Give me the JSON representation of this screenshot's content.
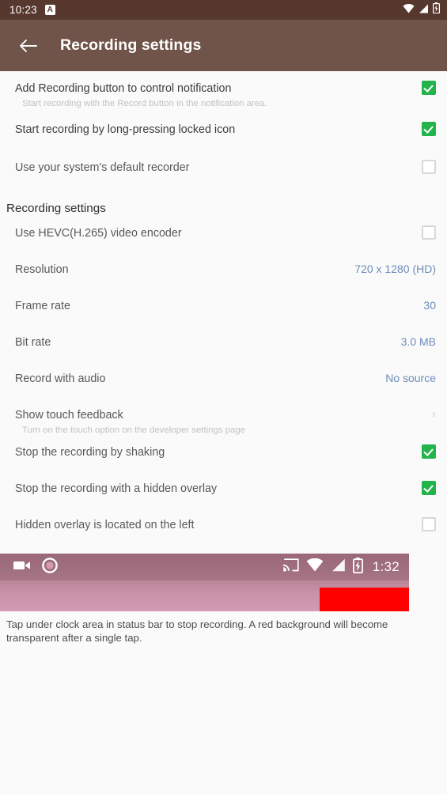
{
  "system_status_bar": {
    "clock": "10:23",
    "badge_label": "A",
    "icons": [
      "wifi-icon",
      "signal-icon",
      "battery-charging-icon"
    ]
  },
  "app_bar": {
    "back_label": "←",
    "title": "Recording settings",
    "background_color": "#70544a"
  },
  "preferences": [
    {
      "title": "Add Recording button to control notification",
      "summary": "Start recording with the Record button in the notification area.",
      "checkbox": "checked"
    },
    {
      "title": "Start recording by long-pressing locked icon",
      "checkbox": "checked"
    },
    {
      "title": "Use your system's default recorder",
      "checkbox": "unchecked"
    }
  ],
  "section": {
    "header": "Recording settings",
    "rows": [
      {
        "title": "Use HEVC(H.265) video encoder",
        "checkbox": "unchecked"
      },
      {
        "title": "Resolution",
        "value": "720 x 1280 (HD)"
      },
      {
        "title": "Frame rate",
        "value": "30"
      },
      {
        "title": "Bit rate",
        "value": "3.0 MB"
      },
      {
        "title": "Record with audio",
        "value": "No source"
      },
      {
        "title": "Show touch feedback",
        "summary": "Turn on the touch option on the developer settings page",
        "chevron": "›"
      },
      {
        "title": "Stop the recording by shaking",
        "checkbox": "checked"
      },
      {
        "title": "Stop the recording with a hidden overlay",
        "checkbox": "checked"
      },
      {
        "title": "Hidden overlay is located on the left",
        "checkbox": "unchecked"
      }
    ]
  },
  "preview": {
    "clock": "1:32",
    "left_icons": [
      "videocam-icon",
      "record-circle-icon"
    ],
    "right_icons": [
      "cast-icon",
      "wifi-icon",
      "signal-icon",
      "battery-charging-icon"
    ],
    "red_block_color": "#fe0000"
  },
  "caption": "Tap under clock area in status bar to stop recording. A red background will become transparent after a single tap.",
  "colors": {
    "status_bar": "#56382e",
    "app_bar": "#70544a",
    "checkbox_on": "#22b34b",
    "value_text": "#6d8cb8",
    "page_background": "#fafafa"
  }
}
